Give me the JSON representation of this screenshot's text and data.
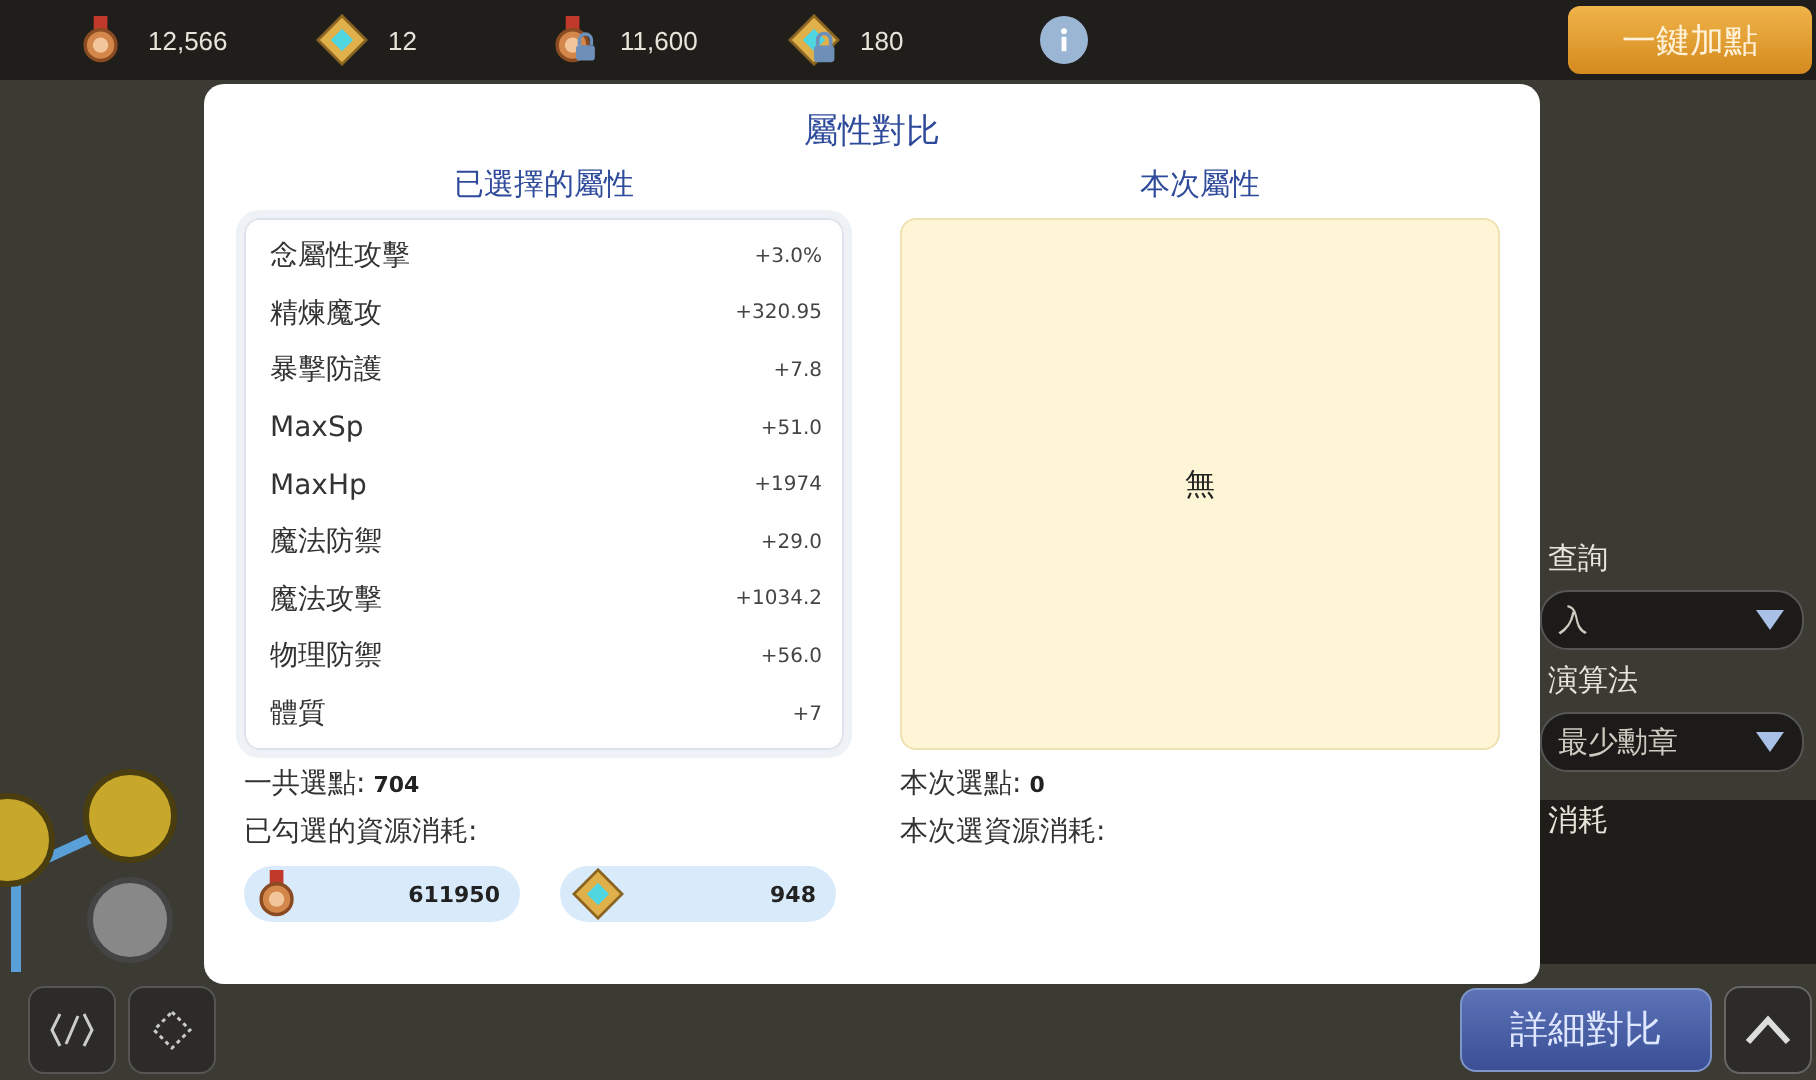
{
  "resources": [
    {
      "kind": "medal",
      "locked": false,
      "value": "12,566"
    },
    {
      "kind": "crystal",
      "locked": false,
      "value": "12"
    },
    {
      "kind": "medal",
      "locked": true,
      "value": "11,600"
    },
    {
      "kind": "crystal",
      "locked": true,
      "value": "180"
    }
  ],
  "auto_button": "一鍵加點",
  "side_panel": {
    "search_label": "查詢",
    "search_select": "入",
    "algorithm_label": "演算法",
    "algorithm_select": "最少勳章",
    "cost_label": "消耗"
  },
  "detail_button": "詳細對比",
  "modal": {
    "title": "屬性對比",
    "left": {
      "heading": "已選擇的屬性",
      "attributes": [
        {
          "name": "念屬性攻擊",
          "value": "+3.0%"
        },
        {
          "name": "精煉魔攻",
          "value": "+320.95"
        },
        {
          "name": "暴擊防護",
          "value": "+7.8"
        },
        {
          "name": "MaxSp",
          "value": "+51.0"
        },
        {
          "name": "MaxHp",
          "value": "+1974"
        },
        {
          "name": "魔法防禦",
          "value": "+29.0"
        },
        {
          "name": "魔法攻擊",
          "value": "+1034.2"
        },
        {
          "name": "物理防禦",
          "value": "+56.0"
        },
        {
          "name": "體質",
          "value": "+7"
        }
      ],
      "points_label": "一共選點:",
      "points": "704",
      "cost_label": "已勾選的資源消耗:",
      "costs": [
        {
          "kind": "medal",
          "value": "611950"
        },
        {
          "kind": "crystal",
          "value": "948"
        }
      ]
    },
    "right": {
      "heading": "本次屬性",
      "empty_text": "無",
      "points_label": "本次選點:",
      "points": "0",
      "cost_label": "本次選資源消耗:"
    }
  }
}
